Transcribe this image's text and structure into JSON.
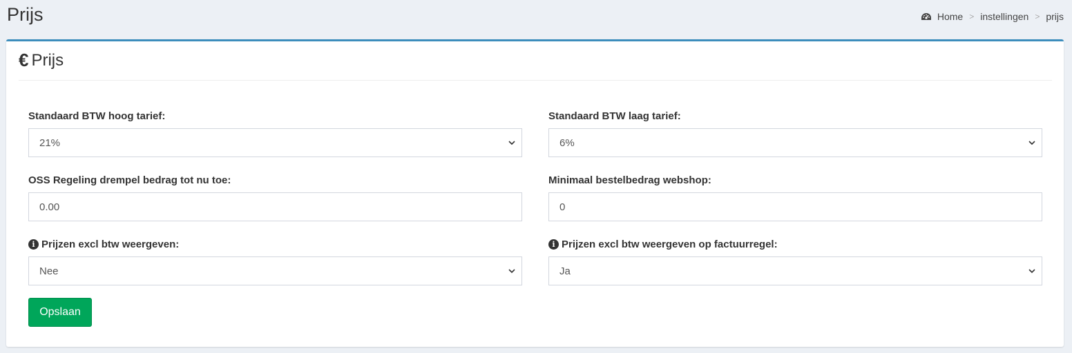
{
  "page": {
    "title": "Prijs"
  },
  "breadcrumb": {
    "icon": "dashboard-icon",
    "items": [
      "Home",
      "instellingen",
      "prijs"
    ],
    "separator": ">"
  },
  "box": {
    "title_icon": "€",
    "title": "Prijs",
    "accent_color": "#3c8dbc"
  },
  "form": {
    "btw_hoog": {
      "label": "Standaard BTW hoog tarief:",
      "value": "21%"
    },
    "btw_laag": {
      "label": "Standaard BTW laag tarief:",
      "value": "6%"
    },
    "oss_drempel": {
      "label": "OSS Regeling drempel bedrag tot nu toe:",
      "value": "0.00"
    },
    "min_bestelbedrag": {
      "label": "Minimaal bestelbedrag webshop:",
      "value": "0"
    },
    "excl_btw": {
      "label": "Prijzen excl btw weergeven:",
      "value": "Nee"
    },
    "excl_btw_factuur": {
      "label": "Prijzen excl btw weergeven op factuurregel:",
      "value": "Ja"
    },
    "save_label": "Opslaan",
    "save_color": "#00a65a"
  }
}
